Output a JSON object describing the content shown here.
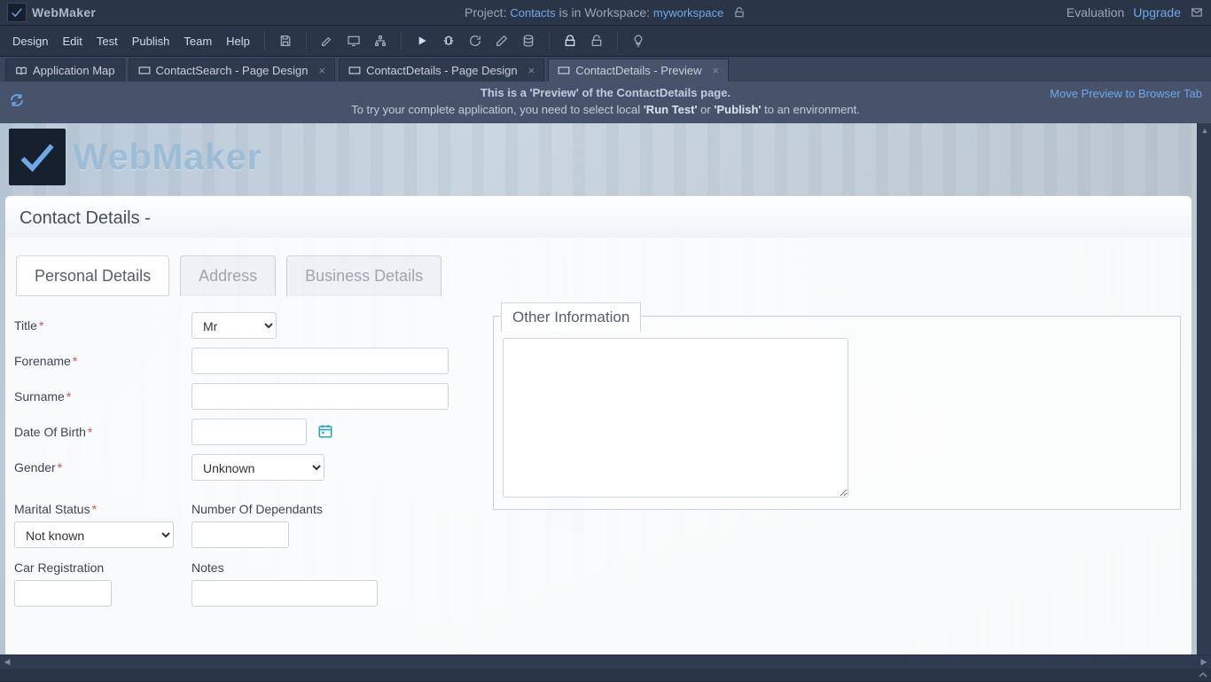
{
  "app": {
    "name": "WebMaker"
  },
  "project_bar": {
    "prefix": "Project: ",
    "project": "Contacts",
    "mid": " is in Workspace: ",
    "workspace": "myworkspace"
  },
  "eval": {
    "label": "Evaluation",
    "upgrade": "Upgrade"
  },
  "menu": [
    "Design",
    "Edit",
    "Test",
    "Publish",
    "Team",
    "Help"
  ],
  "editor_tabs": [
    {
      "label": "Application Map",
      "closable": false,
      "active": false
    },
    {
      "label": "ContactSearch - Page Design",
      "closable": true,
      "active": false
    },
    {
      "label": "ContactDetails - Page Design",
      "closable": true,
      "active": false
    },
    {
      "label": "ContactDetails - Preview",
      "closable": true,
      "active": true
    }
  ],
  "banner": {
    "line1_pre": "This is a ",
    "line1_b1": "'Preview'",
    "line1_mid": " of the ",
    "line1_b2": "ContactDetails",
    "line1_post": " page.",
    "line2_pre": "To try your complete application, you need to select local ",
    "line2_b1": "'Run Test'",
    "line2_mid": " or ",
    "line2_b2": "'Publish'",
    "line2_post": " to an environment.",
    "move_link": "Move Preview to Browser Tab"
  },
  "preview_page": {
    "brand": "WebMaker",
    "panel_title": "Contact Details -",
    "tabs": [
      "Personal Details",
      "Address",
      "Business Details"
    ],
    "fields": {
      "title_label": "Title",
      "title_value": "Mr",
      "forename_label": "Forename",
      "forename_value": "",
      "surname_label": "Surname",
      "surname_value": "",
      "dob_label": "Date Of Birth",
      "dob_value": "",
      "gender_label": "Gender",
      "gender_value": "Unknown",
      "marital_label": "Marital Status",
      "marital_value": "Not known",
      "dependants_label": "Number Of Dependants",
      "dependants_value": "",
      "carreg_label": "Car Registration",
      "carreg_value": "",
      "notes_label": "Notes",
      "notes_value": "",
      "other_info_legend": "Other Information",
      "other_info_value": ""
    }
  }
}
